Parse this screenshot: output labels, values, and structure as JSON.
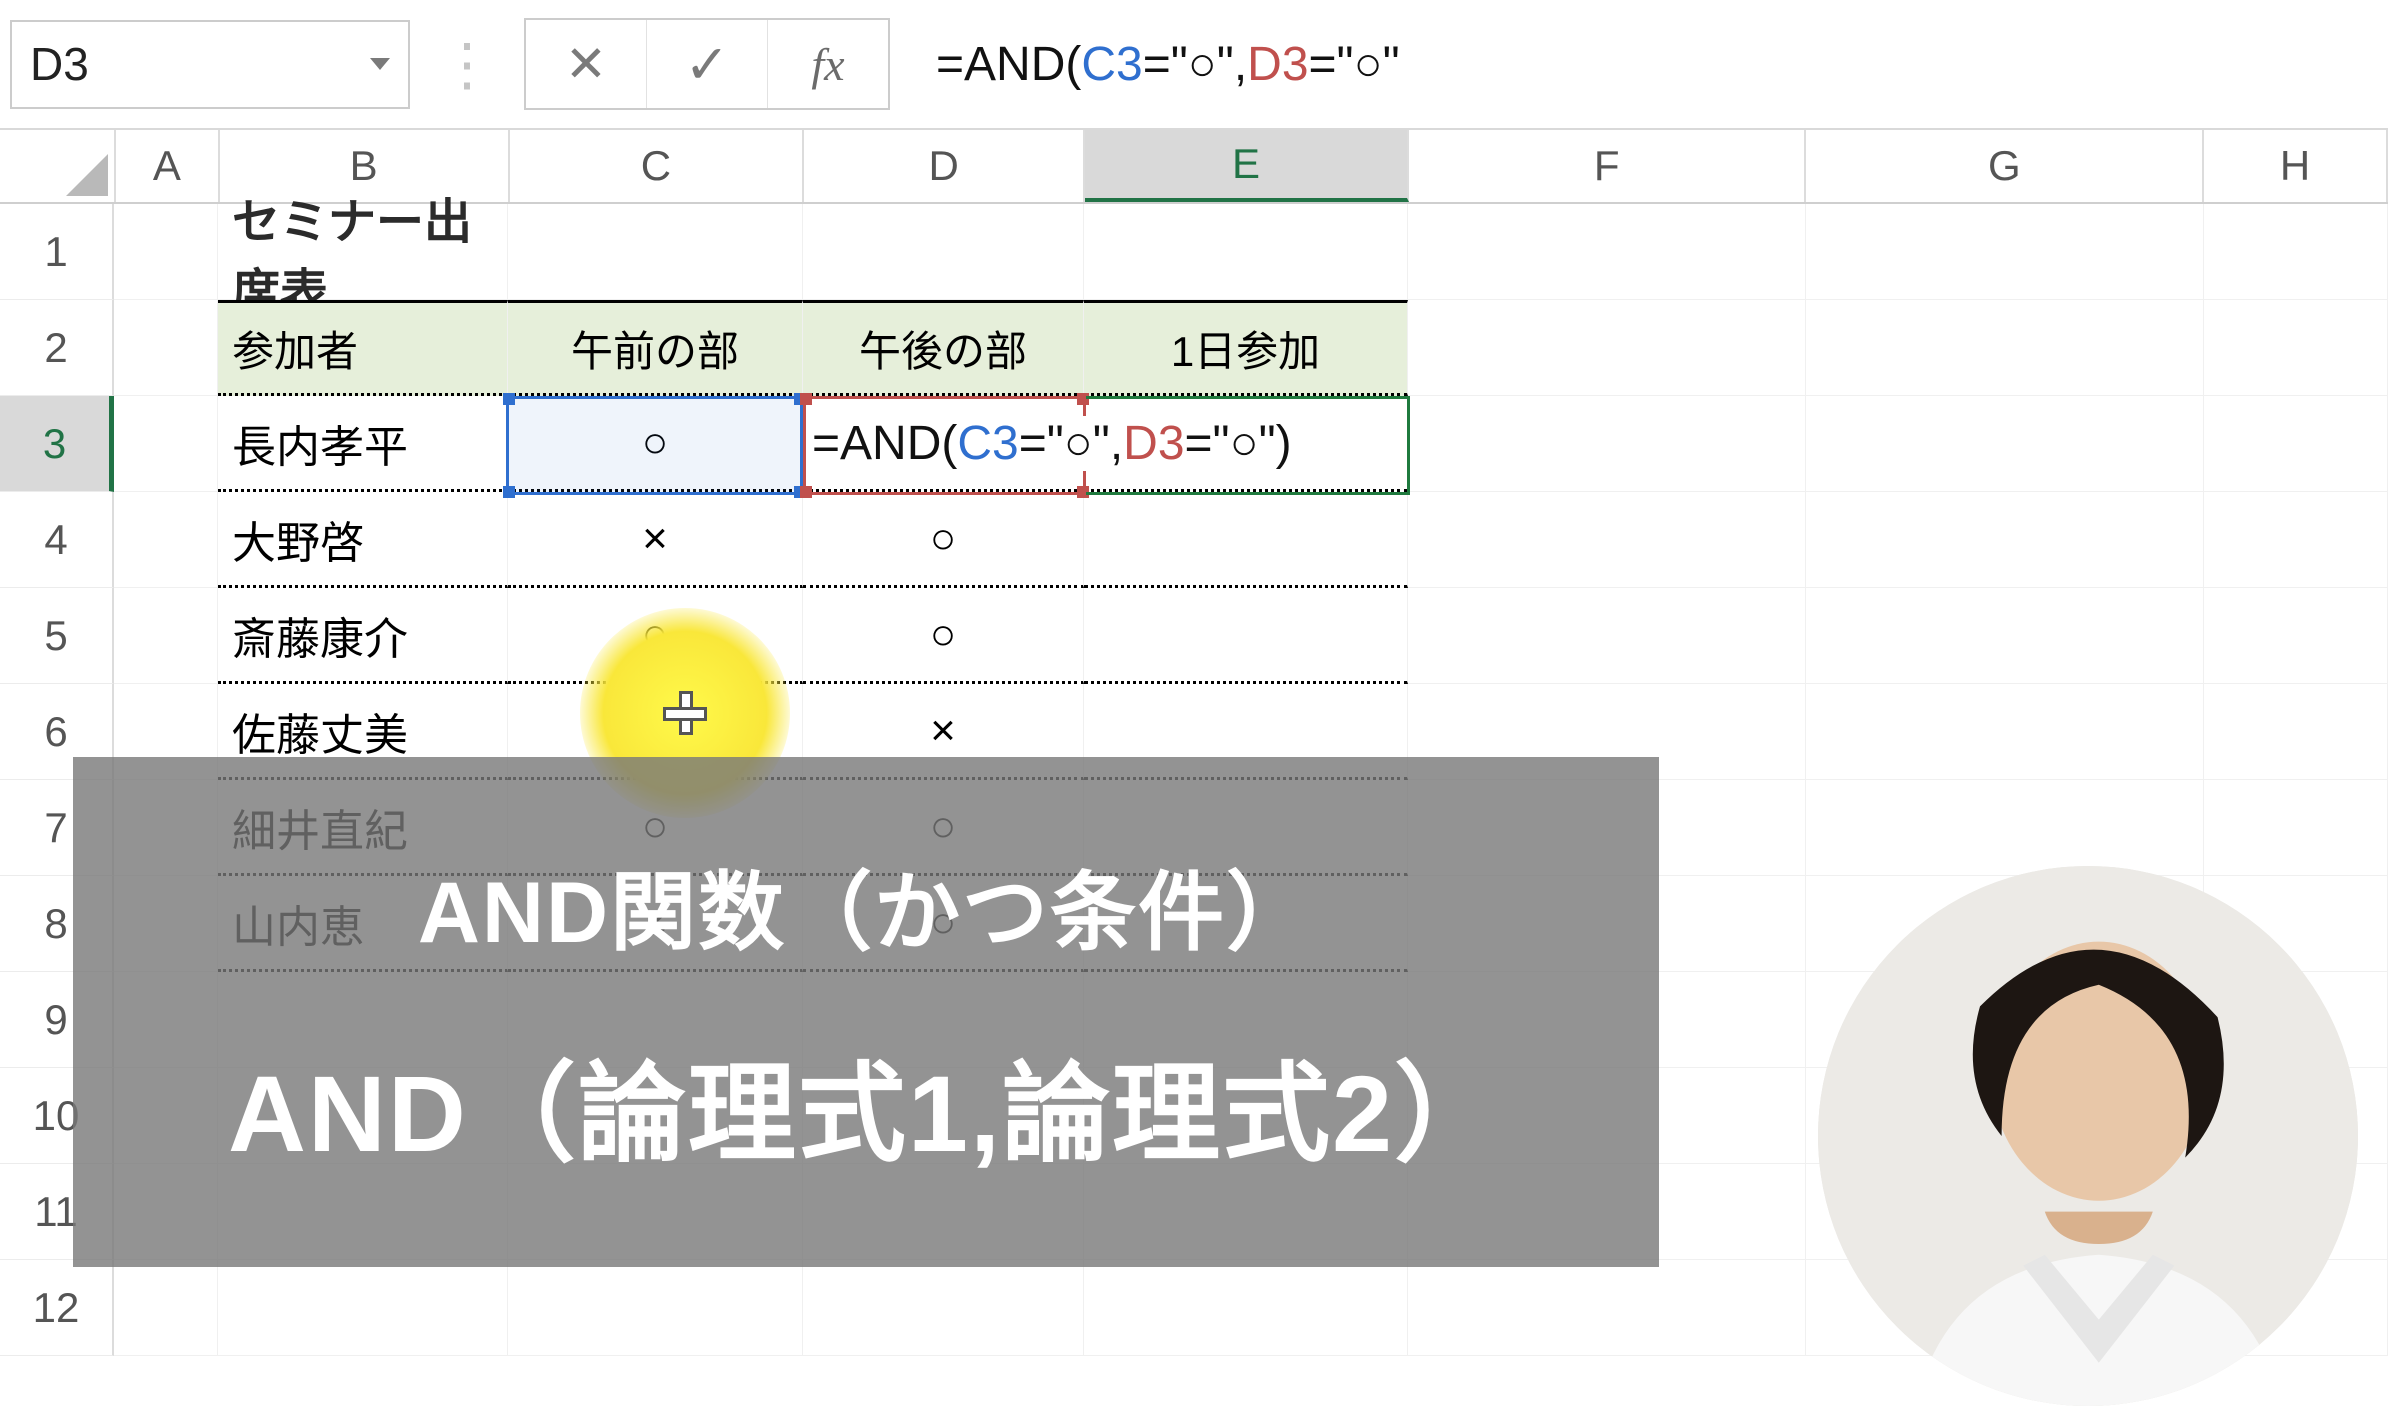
{
  "name_box": {
    "value": "D3"
  },
  "formula_bar": {
    "cancel_icon": "✕",
    "enter_icon": "✓",
    "fx_label": "fx",
    "text_parts": [
      "=AND(",
      "C3",
      "=\"○\",",
      "D3",
      "=\"○\""
    ]
  },
  "columns": [
    "A",
    "B",
    "C",
    "D",
    "E",
    "F",
    "G",
    "H"
  ],
  "active_column": "E",
  "rows": [
    "1",
    "2",
    "3",
    "4",
    "5",
    "6",
    "7",
    "8",
    "9",
    "10",
    "11",
    "12"
  ],
  "active_row": "3",
  "sheet": {
    "title": "セミナー出席表",
    "headers": {
      "participant": "参加者",
      "am": "午前の部",
      "pm": "午後の部",
      "allday": "1日参加"
    },
    "data": [
      {
        "name": "長内孝平",
        "am": "○",
        "pm": "○"
      },
      {
        "name": "大野啓",
        "am": "×",
        "pm": "○"
      },
      {
        "name": "斎藤康介",
        "am": "○",
        "pm": "○"
      },
      {
        "name": "佐藤丈美",
        "am": "○",
        "pm": "×"
      },
      {
        "name": "細井直紀",
        "am": "○",
        "pm": "○"
      },
      {
        "name": "山内恵",
        "am": "×",
        "pm": "○"
      }
    ],
    "editing_formula_parts": [
      "=AND(",
      "C3",
      "=\"○\",",
      "D3",
      "=\"○\")"
    ]
  },
  "caption": {
    "line1": "AND関数（かつ条件）",
    "line2": "AND（論理式1,論理式2）"
  }
}
